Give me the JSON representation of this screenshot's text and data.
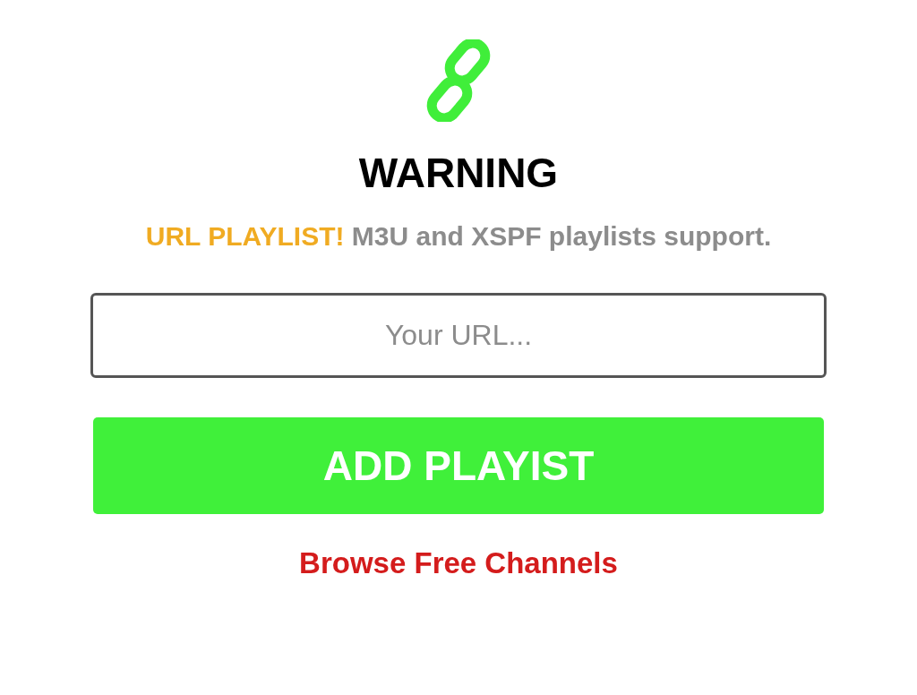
{
  "title": "WARNING",
  "message": {
    "highlight": "URL PLAYLIST!",
    "text": "M3U and XSPF playlists support."
  },
  "url_field": {
    "placeholder": "Your URL..."
  },
  "add_button": {
    "label": "ADD PLAYIST"
  },
  "browse_link": {
    "label": "Browse Free Channels"
  }
}
